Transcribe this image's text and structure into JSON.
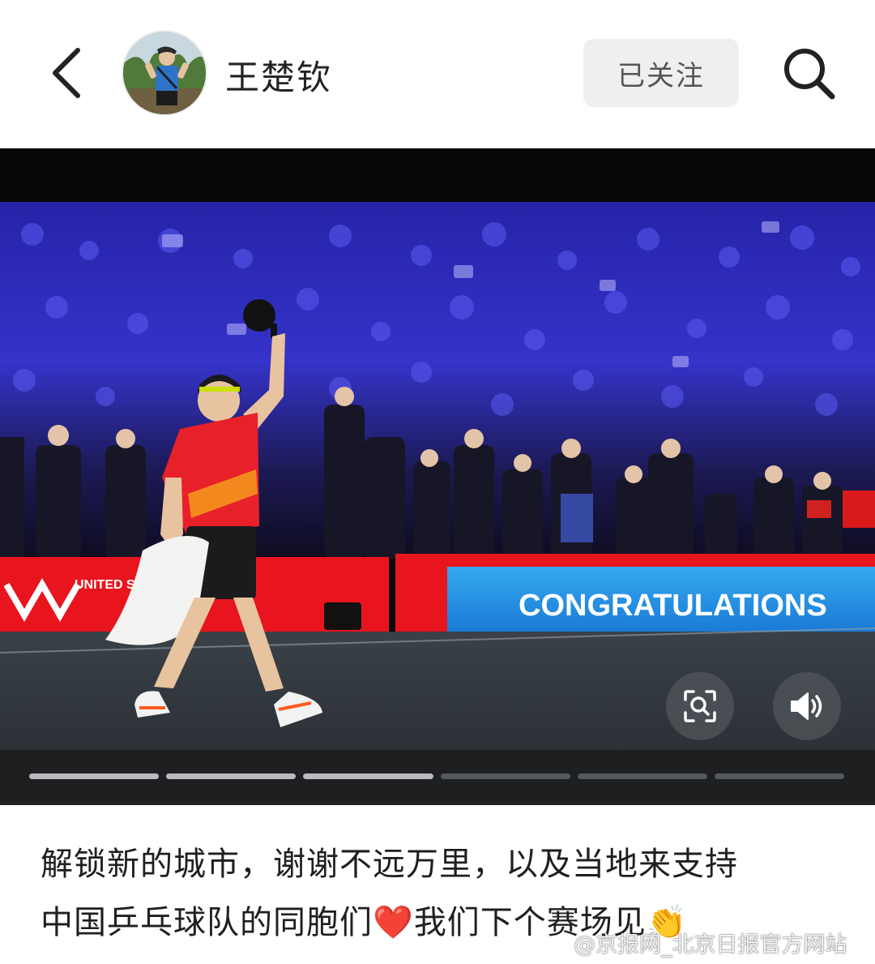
{
  "header": {
    "username": "王楚钦",
    "follow_label": "已关注"
  },
  "media": {
    "banner_text": "CONGRATULATIONS",
    "board_text": "UNITED STA SMA",
    "progress": {
      "total": 6,
      "current": 3
    }
  },
  "caption": {
    "line1": "解锁新的城市，谢谢不远万里，以及当地来支持",
    "line2_a": "中国乒乓球队的同胞们",
    "heart": "❤️",
    "line2_b": "我们下个赛场见",
    "clap": "👏"
  },
  "watermark": "@京报网_北京日报官方网站",
  "icons": {
    "back": "chevron-left-icon",
    "search": "search-icon",
    "zoom": "scan-zoom-icon",
    "sound": "speaker-volume-icon"
  },
  "colors": {
    "follow_bg": "#efefef",
    "banner": "#1a8fe0",
    "board": "#e8141e",
    "crowd": "#2e2fc9"
  }
}
